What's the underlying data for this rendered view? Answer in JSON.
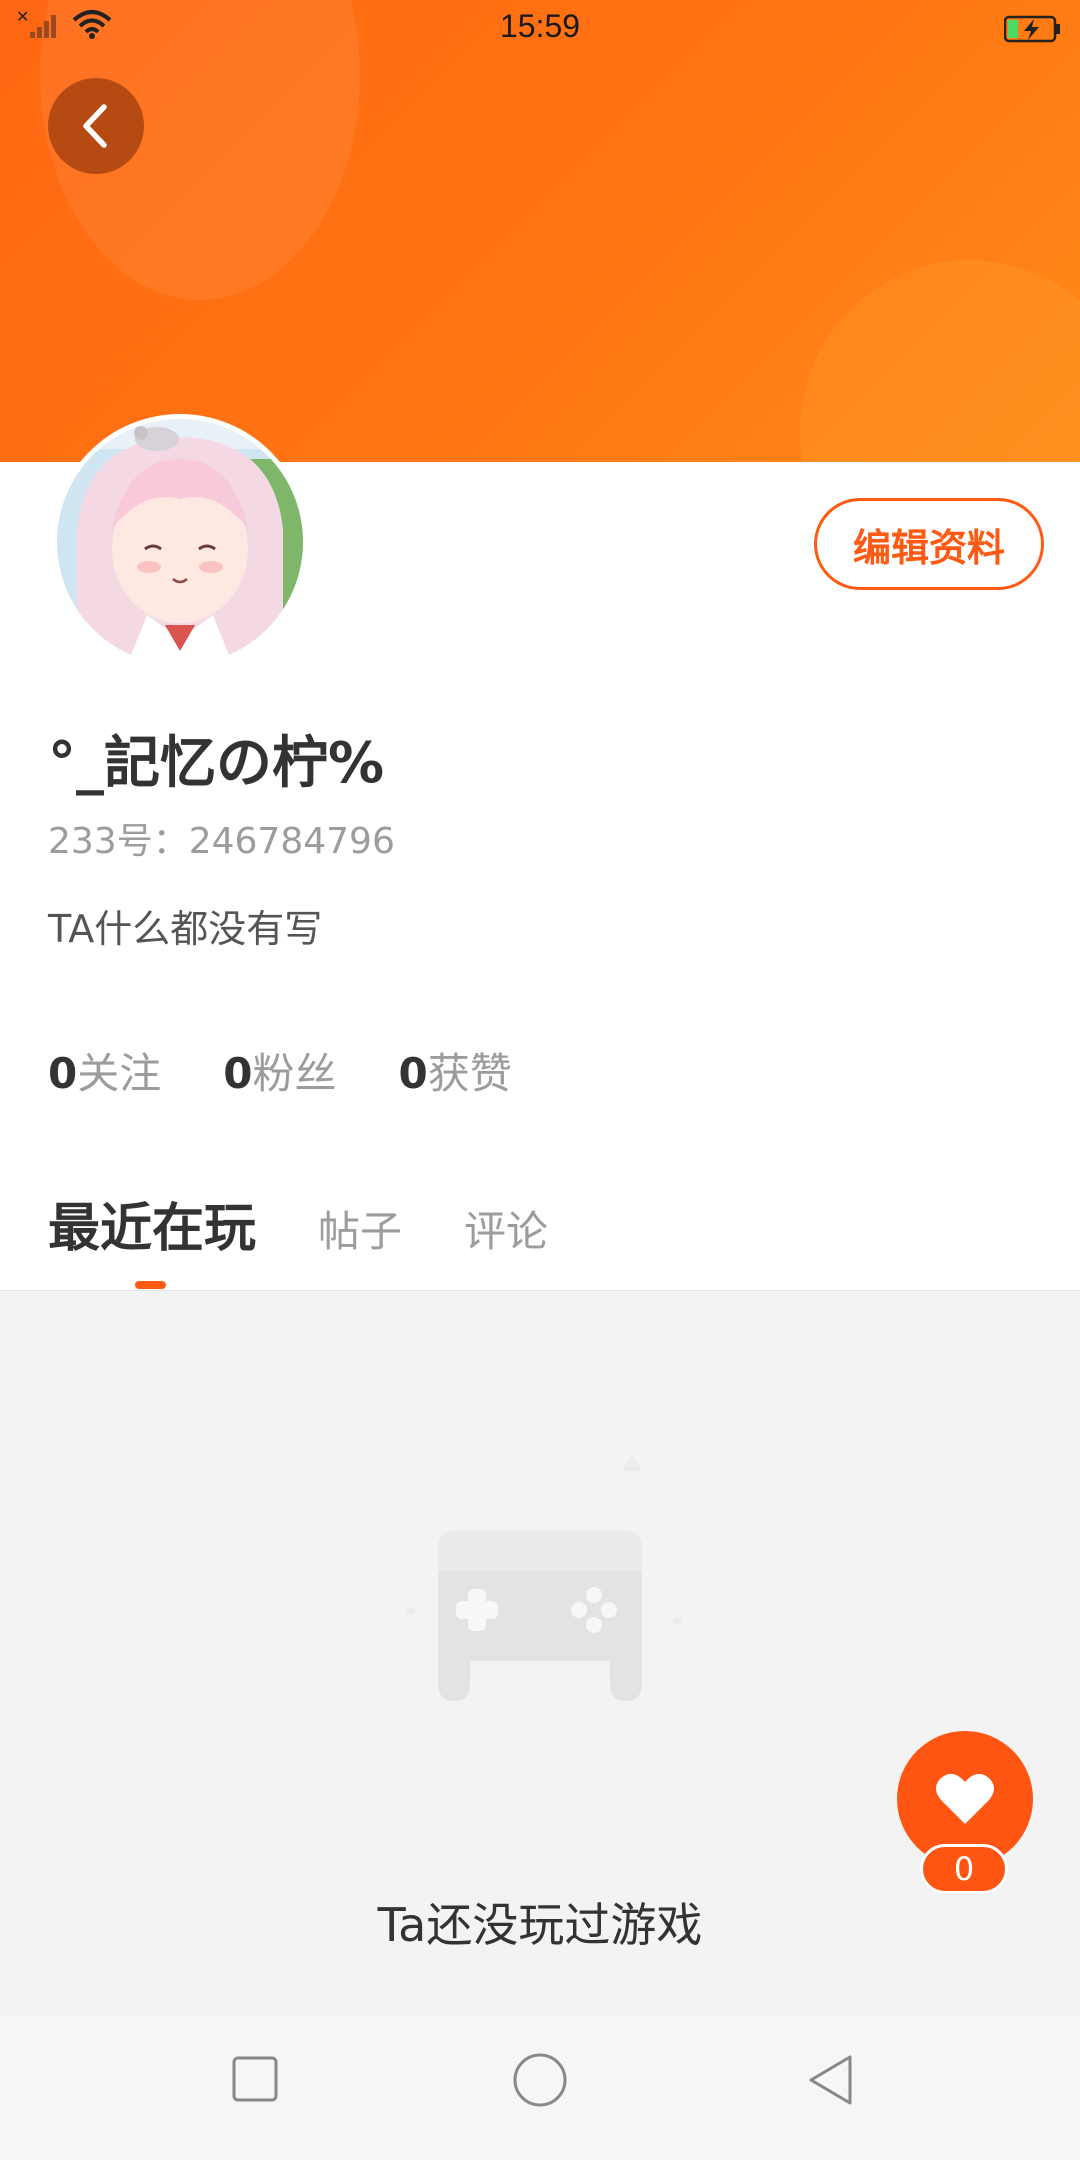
{
  "status_bar": {
    "time": "15:59",
    "icons": [
      "signal-icon",
      "wifi-icon",
      "battery-charging-icon"
    ]
  },
  "header": {
    "back_icon": "chevron-left-icon"
  },
  "profile": {
    "edit_button": "编辑资料",
    "nickname": "°_記忆の柠%",
    "uid": "233号：246784796",
    "bio": "TA什么都没有写"
  },
  "stats": [
    {
      "num": "0",
      "label": "关注"
    },
    {
      "num": "0",
      "label": "粉丝"
    },
    {
      "num": "0",
      "label": "获赞"
    }
  ],
  "tabs": [
    {
      "label": "最近在玩",
      "active": true
    },
    {
      "label": "帖子",
      "active": false
    },
    {
      "label": "评论",
      "active": false
    }
  ],
  "empty_state": {
    "icon": "gamepad-icon",
    "text": "Ta还没玩过游戏"
  },
  "like": {
    "icon": "heart-icon",
    "count": "0"
  },
  "nav": {
    "icons": [
      "recent-apps-icon",
      "home-icon",
      "back-triangle-icon"
    ]
  },
  "colors": {
    "accent": "#ff5a14",
    "banner": "#ff6f12"
  }
}
